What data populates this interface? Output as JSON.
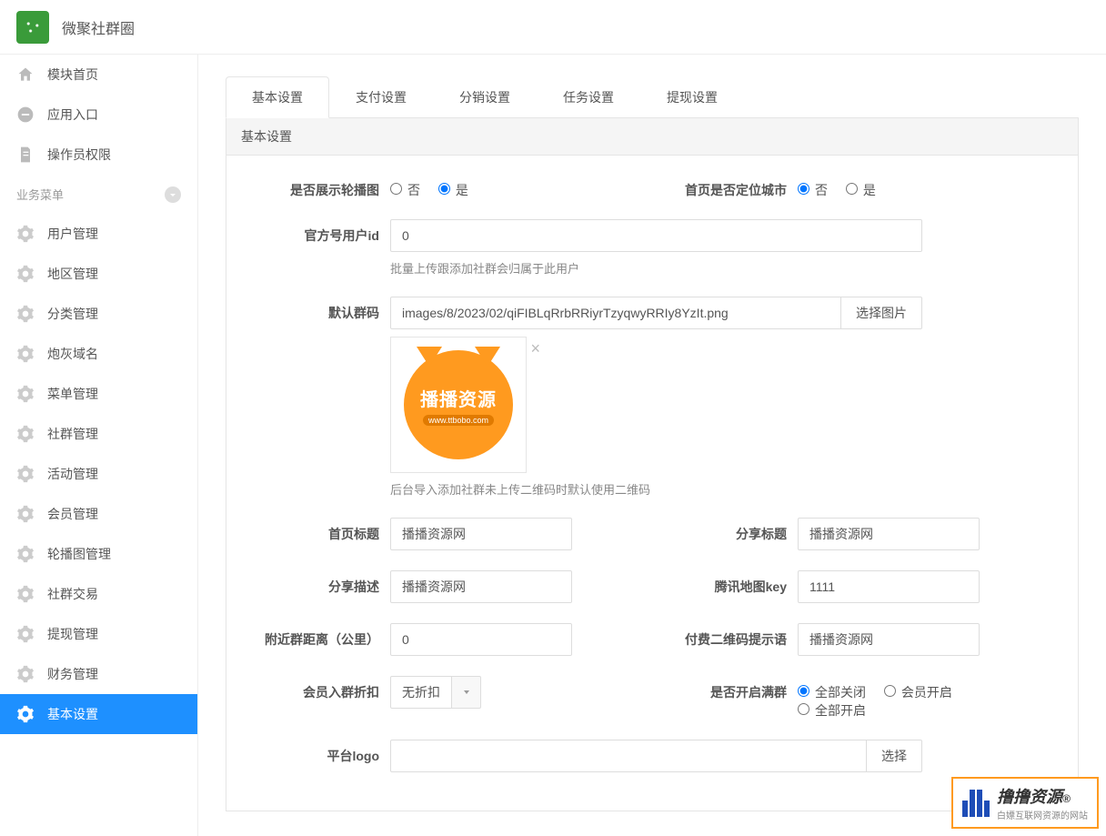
{
  "app": {
    "title": "微聚社群圈"
  },
  "sidebar": {
    "top": [
      {
        "label": "模块首页",
        "name": "sidebar-module-home"
      },
      {
        "label": "应用入口",
        "name": "sidebar-app-entry"
      },
      {
        "label": "操作员权限",
        "name": "sidebar-operator-perms"
      }
    ],
    "section_label": "业务菜单",
    "items": [
      {
        "label": "用户管理",
        "name": "sidebar-user-mgmt"
      },
      {
        "label": "地区管理",
        "name": "sidebar-region-mgmt"
      },
      {
        "label": "分类管理",
        "name": "sidebar-category-mgmt"
      },
      {
        "label": "炮灰域名",
        "name": "sidebar-cannon-domain"
      },
      {
        "label": "菜单管理",
        "name": "sidebar-menu-mgmt"
      },
      {
        "label": "社群管理",
        "name": "sidebar-community-mgmt"
      },
      {
        "label": "活动管理",
        "name": "sidebar-activity-mgmt"
      },
      {
        "label": "会员管理",
        "name": "sidebar-member-mgmt"
      },
      {
        "label": "轮播图管理",
        "name": "sidebar-carousel-mgmt"
      },
      {
        "label": "社群交易",
        "name": "sidebar-community-trade"
      },
      {
        "label": "提现管理",
        "name": "sidebar-withdraw-mgmt"
      },
      {
        "label": "财务管理",
        "name": "sidebar-finance-mgmt"
      },
      {
        "label": "基本设置",
        "name": "sidebar-basic-settings",
        "active": true
      }
    ]
  },
  "tabs": [
    {
      "label": "基本设置",
      "active": true
    },
    {
      "label": "支付设置"
    },
    {
      "label": "分销设置"
    },
    {
      "label": "任务设置"
    },
    {
      "label": "提现设置"
    }
  ],
  "panel": {
    "title": "基本设置"
  },
  "form": {
    "show_carousel": {
      "label": "是否展示轮播图",
      "no": "否",
      "yes": "是",
      "value": "yes"
    },
    "locate_city": {
      "label": "首页是否定位城市",
      "no": "否",
      "yes": "是",
      "value": "no"
    },
    "official_uid": {
      "label": "官方号用户id",
      "value": "0",
      "help": "批量上传跟添加社群会归属于此用户"
    },
    "default_qr": {
      "label": "默认群码",
      "value": "images/8/2023/02/qiFIBLqRrbRRiyrTzyqwyRRIy8YzIt.png",
      "btn": "选择图片",
      "help": "后台导入添加社群未上传二维码时默认使用二维码",
      "preview_text1": "播播资源",
      "preview_text2": "www.ttbobo.com"
    },
    "home_title": {
      "label": "首页标题",
      "value": "播播资源网"
    },
    "share_title": {
      "label": "分享标题",
      "value": "播播资源网"
    },
    "share_desc": {
      "label": "分享描述",
      "value": "播播资源网"
    },
    "map_key": {
      "label": "腾讯地图key",
      "value": "1111"
    },
    "nearby_distance": {
      "label": "附近群距离（公里）",
      "value": "0"
    },
    "paid_qr_tip": {
      "label": "付费二维码提示语",
      "value": "播播资源网"
    },
    "member_discount": {
      "label": "会员入群折扣",
      "value": "无折扣"
    },
    "full_group": {
      "label": "是否开启满群",
      "opt1": "全部关闭",
      "opt2": "会员开启",
      "opt3": "全部开启",
      "value": "opt1"
    },
    "platform_logo": {
      "label": "平台logo",
      "value": "",
      "btn": "选择"
    }
  },
  "watermark": {
    "t1": "撸撸资源",
    "t2": "白嫖互联网资源的网站",
    "r": "®"
  }
}
